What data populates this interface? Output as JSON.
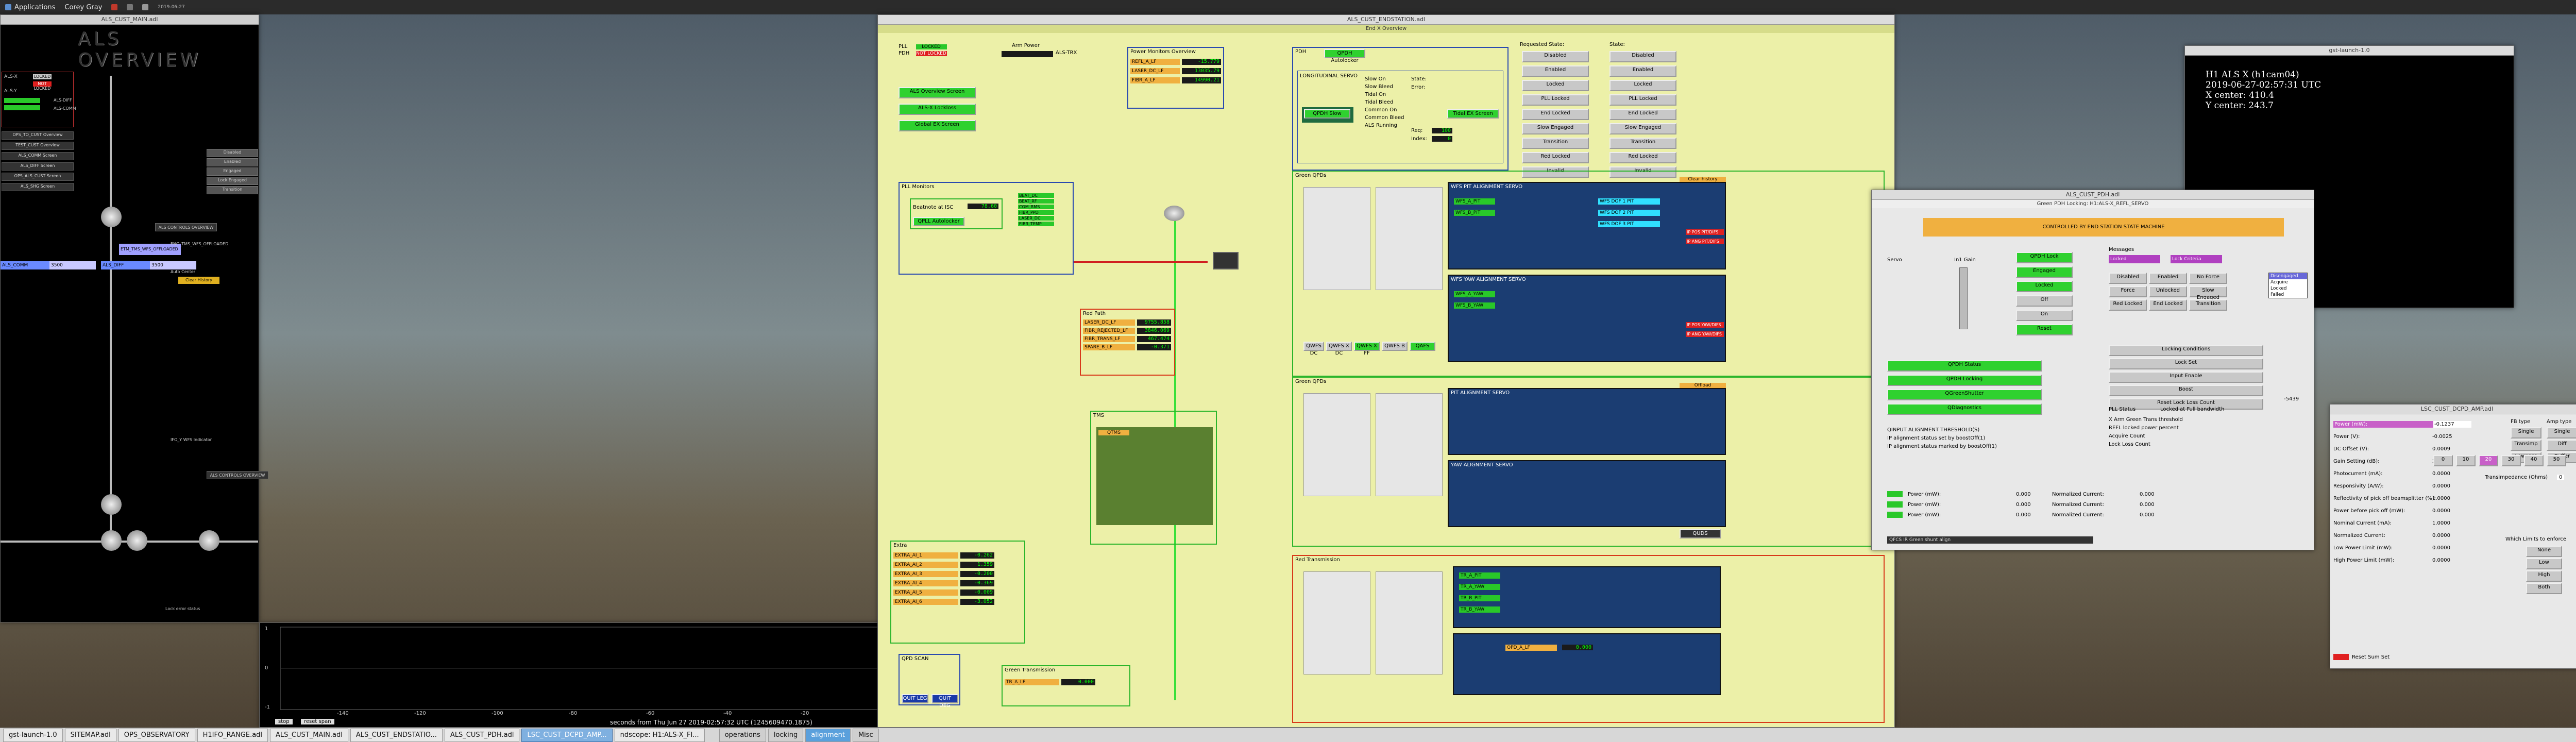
{
  "top_panel": {
    "applications": "Applications",
    "user": "Corey Gray",
    "clock": "2019-06-27"
  },
  "als_main": {
    "title": "ALS_CUST_MAIN.adl",
    "banner": "ALS OVERVIEW",
    "pll_labels": [
      "ALS-X",
      "ALS-Y",
      "ALS-DIFF",
      "ALS-COMM"
    ],
    "status": [
      "LOCKED",
      "NOT LOCKED",
      "LOCKED",
      "LOCKED"
    ],
    "screens": [
      "ALS COMM LOCKED",
      "Set Arm Lock",
      "Shutter Screen",
      "Fiber Distribution"
    ],
    "buttons_left": [
      "OPS_TO_CUST Overview",
      "TEST_CUST Overview",
      "ALS_COMM Screen",
      "ALS_DIFF Screen",
      "OPS_ALS_CUST Screen",
      "ALS_SHG Screen"
    ],
    "sums": [
      "ALS_COMM",
      "ALS_DIFF"
    ],
    "sum_vals": [
      "3500",
      "3500"
    ],
    "wfs_indicator": "ENG_TMS_WFS_OFFLOADED",
    "wfs_labels": [
      "ETM_TMS_WFS_OFFLOADED",
      "ETM_TMS_WFS_OFFLOADED"
    ],
    "auto_center": "Auto Center",
    "clear_history": "Clear History",
    "ifo_indicator": "IFO_Y WFS Indicator",
    "lock_error": "Lock error status",
    "controls": "ALS CONTROLS OVERVIEW",
    "right_buttons": [
      "Disabled",
      "Enabled",
      "Engaged",
      "Lock Engaged",
      "Transition"
    ],
    "plot_title": "seconds from Thu Jun 27 2019-02:57:32 UTC (1245609470.1875)",
    "plot_ticks": [
      "-140",
      "-120",
      "-100",
      "-80",
      "-60",
      "-40",
      "-20",
      "0"
    ],
    "plot_yticks": [
      "1",
      "0",
      "-1"
    ],
    "stop": "stop",
    "reset_span": "reset span",
    "history": "history"
  },
  "endstation": {
    "title": "ALS_CUST_ENDSTATION.adl",
    "subtitle": "End X Overview",
    "pll": [
      "PLL",
      "PDH"
    ],
    "pll_status": [
      "LOCKED",
      "NOT LOCKED"
    ],
    "arm_power": "Arm Power",
    "arm_power_val": "ALS-TRX",
    "als_buttons": [
      "ALS Overview Screen",
      "ALS-X Lockloss",
      "Global EX Screen"
    ],
    "power_monitors": "Power Monitors Overview",
    "power_rows": [
      {
        "l": "REFL_A_LF",
        "v": "-15.779"
      },
      {
        "l": "LASER_DC_LF",
        "v": "13035.79"
      },
      {
        "l": "FIBR_A_LF",
        "v": "14990.21"
      }
    ],
    "pdh": "PDH",
    "pdh_btn": "QPDH Autolocker",
    "servo": "LONGITUDINAL SERVO",
    "servo_states": [
      "Slow On",
      "Slow Bleed",
      "Tidal On",
      "Tidal Bleed",
      "Common On",
      "Common Bleed",
      "ALS Running"
    ],
    "state_labels": [
      "State:",
      "Error:",
      "Req:",
      "Index:"
    ],
    "state_vals": [
      "100",
      "0"
    ],
    "qpdh_slow": "QPDH Slow",
    "tidal_screen": "Tidal EX Screen",
    "requested_state": "Requested State:",
    "states_hdr": "State:",
    "states": [
      "Disabled",
      "Enabled",
      "Locked",
      "PLL Locked",
      "End Locked",
      "Slow Engaged",
      "Transition",
      "Red Locked",
      "Invalid"
    ],
    "pll_monitors": "PLL Monitors",
    "beatnote": "Beatnote at ISC",
    "beatnote_val": "78.60",
    "pll_list": [
      "BEAT_DC",
      "BEAT_RF",
      "COM_RMS",
      "FIBR_PPD",
      "LASER_DC",
      "FIBR_TEMP"
    ],
    "pll_lock": "QPLL Autolocker",
    "red_path": "Red Path",
    "red_rows": [
      {
        "l": "LASER_DC_LF",
        "v": "9755.858"
      },
      {
        "l": "FIBR_REJECTED_LF",
        "v": "3846.069"
      },
      {
        "l": "FIBR_TRANS_LF",
        "v": "467.474"
      },
      {
        "l": "SPARE_B_LF",
        "v": "-0.371"
      }
    ],
    "green_qpds": "Green QPDs",
    "qpd_tags": [
      "QWFS DC",
      "QWFS X DC",
      "QWFS X FF",
      "QWFS B",
      "QAFS"
    ],
    "wfs_pit_servo": "WFS PIT ALIGNMENT SERVO",
    "wfs_yaw_servo": "WFS YAW ALIGNMENT SERVO",
    "pit_servo": "PIT ALIGNMENT SERVO",
    "yaw_servo": "YAW ALIGNMENT SERVO",
    "servo_rows": [
      "WFS_A_PIT",
      "WFS_B_PIT",
      "WFS_A_YAW",
      "WFS_B_YAW"
    ],
    "dof_labels": [
      "WFS DOF 1 PIT",
      "WFS DOF 2 PIT",
      "WFS DOF 3 PIT"
    ],
    "outputs": [
      "IP POS PIT/DIFS",
      "IP ANG PIT/DIFS",
      "IP POS YAW/DIFS",
      "IP ANG YAW/DIFS"
    ],
    "clear_history": "Clear history",
    "offload": "Offload",
    "quds": "QUDS",
    "extra": "Extra",
    "extra_rows": [
      {
        "l": "EXTRA_AI_1",
        "v": "-0.262"
      },
      {
        "l": "EXTRA_AI_2",
        "v": "1.359"
      },
      {
        "l": "EXTRA_AI_3",
        "v": "-0.200"
      },
      {
        "l": "EXTRA_AI_4",
        "v": "-0.369"
      },
      {
        "l": "EXTRA_AI_5",
        "v": "-0.009"
      },
      {
        "l": "EXTRA_AI_6",
        "v": "-3.052"
      }
    ],
    "trans_green": "Green Transmission",
    "trans_green_row": {
      "l": "TR_A_LF",
      "v": "0.000"
    },
    "red_trans": "Red Transmission",
    "red_trans_rows": [
      "TR_A_PIT",
      "TR_A_YAW",
      "TR_B_PIT",
      "TR_B_YAW"
    ],
    "qpd_scan": "QPD SCAN",
    "qpd_thresh": "QPD_A_LF",
    "end_labels": [
      "QTMS",
      "TMS"
    ],
    "qpd_a_val": "0.000",
    "bottom_btns": [
      "QUIT LEG",
      "QUIT DEG"
    ]
  },
  "terminal": {
    "title": "gst-launch-1.0",
    "lines": [
      "H1 ALS X (h1cam04)",
      "2019-06-27-02:57:31 UTC",
      "X center: 410.4",
      "Y center: 243.7"
    ]
  },
  "pdh": {
    "title": "ALS_CUST_PDH.adl",
    "subtitle": "Green PDH Locking: H1:ALS-X_REFL_SERVO",
    "banner": "CONTROLLED BY END STATION STATE MACHINE",
    "labels": [
      "Servo",
      "In1 Gain",
      "Offset",
      "Slow Loop",
      "Fast Loop",
      "Locking Conditions"
    ],
    "buttons": [
      "QPDH Lock",
      "Engaged",
      "Locked",
      "Off",
      "On",
      "Reset"
    ],
    "right_labels": [
      "Messages",
      "Locked",
      "Lock Criteria",
      "Disabled",
      "Enabled",
      "No Force",
      "Force",
      "Unlocked",
      "Slow Engaged",
      "Red Locked",
      "End Locked",
      "Transition"
    ],
    "state_box": [
      "Disengaged",
      "Acquire",
      "Locked",
      "Failed"
    ],
    "settings": [
      "Locking Conditions",
      "Lock Set",
      "Input Enable",
      "Boost",
      "Reset Lock Loss Count"
    ],
    "thresholds": [
      "QINPUT ALIGNMENT THRESHOLD(S)",
      "IP alignment status set by boostOff(1)",
      "IP alignment status marked by boostOff(1)"
    ],
    "monitor_labels": [
      "X Arm Green Trans threshold",
      "REFL locked power percent",
      "Acquire Count",
      "Lock Loss Count"
    ],
    "bottom_btns": [
      "QPDH Status",
      "QPDH Locking",
      "QGreenShutter",
      "QDiagnostics"
    ],
    "powers": [
      "Power (mW):",
      "Power (mW):",
      "Power (mW):"
    ],
    "power_vals": [
      "0.000",
      "0.000",
      "0.000"
    ],
    "normalized": [
      "Normalized Current:",
      "Normalized Current:",
      "Normalized Current:"
    ],
    "norm_vals": [
      "0.000",
      "0.000",
      "0.000"
    ],
    "interlock": "QFCS IR Green shunt align",
    "pll_gain_label": "PLL Status",
    "pll_locked": "Locked at Full bandwidth",
    "lock_vals": [
      "-5439",
      "0"
    ]
  },
  "dcpd": {
    "title": "LSC_CUST_DCPD_AMP.adl",
    "rows": [
      "Power (mW):",
      "Power (V):",
      "DC Offset (V):",
      "Gain Setting (dB):",
      "Photocurrent (mA):",
      "Responsivity (A/W):",
      "Reflectivity of pick off beamsplitter (%):",
      "Power before pick off (mW):",
      "Nominal Current (mA):",
      "Normalized Current:",
      "Low Power Limit (mW):",
      "High Power Limit (mW):"
    ],
    "vals": [
      "-0.1237",
      "-0.0025",
      "0.0009",
      "20",
      "0.0000",
      "0.0000",
      "1.0000",
      "0.0000",
      "1.0000",
      "0.0000",
      "0.0000",
      "0.0000"
    ],
    "fb_type": "FB type",
    "amp_type": "Amp type",
    "fb_options": [
      "Single",
      "Transimp",
      "Lowpass"
    ],
    "amp_options": [
      "Single",
      "Diff",
      "Buffer"
    ],
    "gain_buttons": [
      "0",
      "10",
      "20",
      "30",
      "40",
      "50"
    ],
    "whitening": "Which Limits to enforce",
    "limit_opts": [
      "None",
      "Low",
      "High",
      "Both"
    ],
    "ext_label": "Reset Sum Set",
    "transimpedance": "Transimpedance (Ohms)",
    "trans_val": "0"
  },
  "taskbar": {
    "tasks": [
      "gst-launch-1.0",
      "SITEMAP.adl",
      "OPS_OBSERVATORY",
      "H1IFO_RANGE.adl",
      "ALS_CUST_MAIN.adl",
      "ALS_CUST_ENDSTATIO...",
      "ALS_CUST_PDH.adl",
      "LSC_CUST_DCPD_AMP...",
      "ndscope: H1:ALS-X_FI..."
    ],
    "active_task": 7,
    "workspaces": [
      "operations",
      "locking",
      "alignment",
      "Misc"
    ],
    "active_ws": 2
  }
}
